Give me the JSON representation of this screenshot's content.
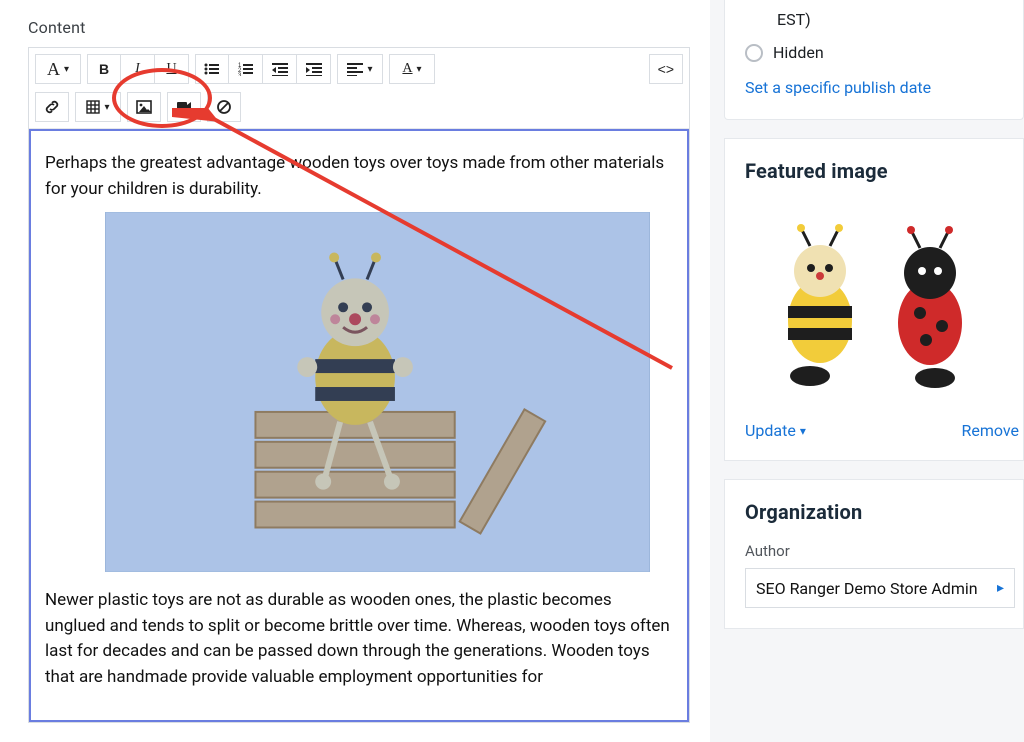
{
  "editor": {
    "label": "Content",
    "paragraph1": "Perhaps the greatest advantage wooden toys over toys made from other materials for your children is durability.",
    "paragraph2": "Newer plastic toys are not as durable as wooden ones, the plastic becomes unglued and tends to split or become brittle over time.  Whereas, wooden toys often last for decades and can be passed down through the generations. Wooden toys that are handmade provide valuable employment opportunities for",
    "codeToggle": "<>"
  },
  "toolbar": {
    "font_letter": "A",
    "bold": "B",
    "italic": "I",
    "underline": "U"
  },
  "visibility": {
    "schedule_tail": "EST)",
    "hidden": "Hidden",
    "set_date": "Set a specific publish date"
  },
  "featured": {
    "title": "Featured image",
    "update": "Update",
    "remove": "Remove"
  },
  "organization": {
    "title": "Organization",
    "author_label": "Author",
    "author_value": "SEO Ranger Demo Store Admin"
  }
}
